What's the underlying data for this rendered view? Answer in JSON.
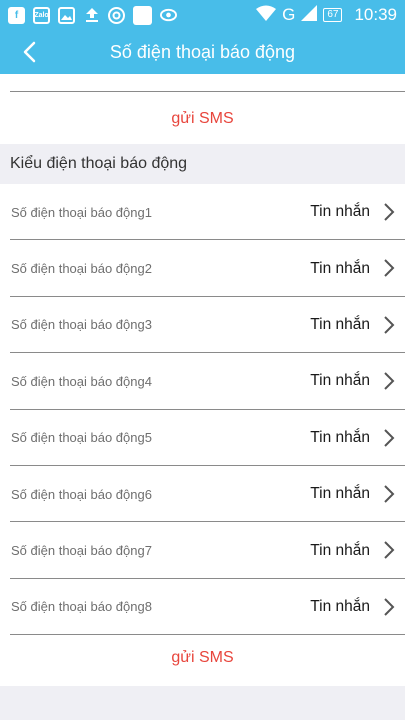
{
  "status_bar": {
    "icons": [
      "facebook-icon",
      "zalo-icon",
      "image-icon",
      "upload-icon",
      "chrome-icon",
      "square-app-icon",
      "eye-icon"
    ],
    "zalo_label": "Zalo",
    "network": "G",
    "battery": "67",
    "time": "10:39"
  },
  "nav": {
    "title": "Số điện thoại báo động",
    "back_icon": "chevron-left-icon"
  },
  "top": {
    "send_sms": "gửi SMS"
  },
  "section": {
    "header": "Kiểu điện thoại báo động"
  },
  "rows": [
    {
      "label": "Số điện thoại báo động1",
      "value": "Tin nhắn"
    },
    {
      "label": "Số điện thoại báo động2",
      "value": "Tin nhắn"
    },
    {
      "label": "Số điện thoại báo động3",
      "value": "Tin nhắn"
    },
    {
      "label": "Số điện thoại báo động4",
      "value": "Tin nhắn"
    },
    {
      "label": "Số điện thoại báo động5",
      "value": "Tin nhắn"
    },
    {
      "label": "Số điện thoại báo động6",
      "value": "Tin nhắn"
    },
    {
      "label": "Số điện thoại báo động7",
      "value": "Tin nhắn"
    },
    {
      "label": "Số điện thoại báo động8",
      "value": "Tin nhắn"
    }
  ],
  "bottom": {
    "send_sms": "gửi SMS"
  },
  "colors": {
    "header_blue": "#48bde9",
    "accent_red": "#e8453c",
    "background_gray": "#efeff4"
  }
}
